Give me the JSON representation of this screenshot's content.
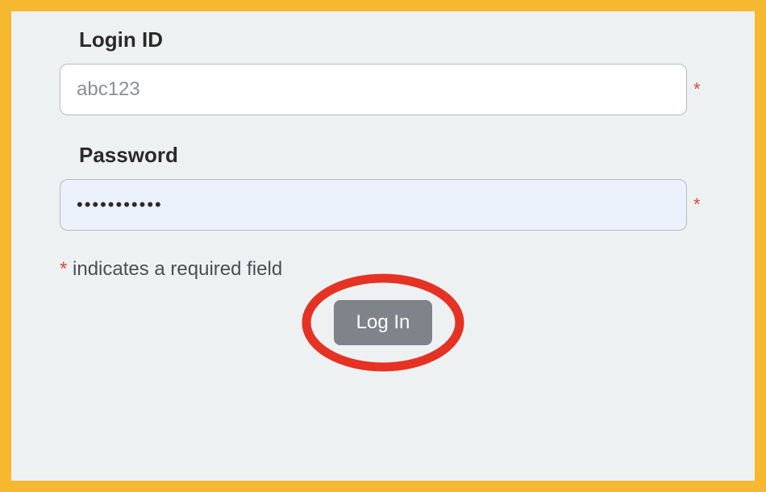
{
  "form": {
    "login_id": {
      "label": "Login ID",
      "value": "",
      "placeholder": "abc123",
      "required_marker": "*"
    },
    "password": {
      "label": "Password",
      "value": "•••••••••••",
      "required_marker": "*"
    },
    "required_note_star": "*",
    "required_note_text": " indicates a required field",
    "login_button_label": "Log In"
  },
  "colors": {
    "frame_border": "#f5b82e",
    "background": "#eef1f2",
    "input_border": "#b7bcc0",
    "password_bg": "#eaf1fb",
    "required_star": "#d94b3a",
    "button_bg": "#7e8489",
    "highlight_ring": "#e53224"
  }
}
